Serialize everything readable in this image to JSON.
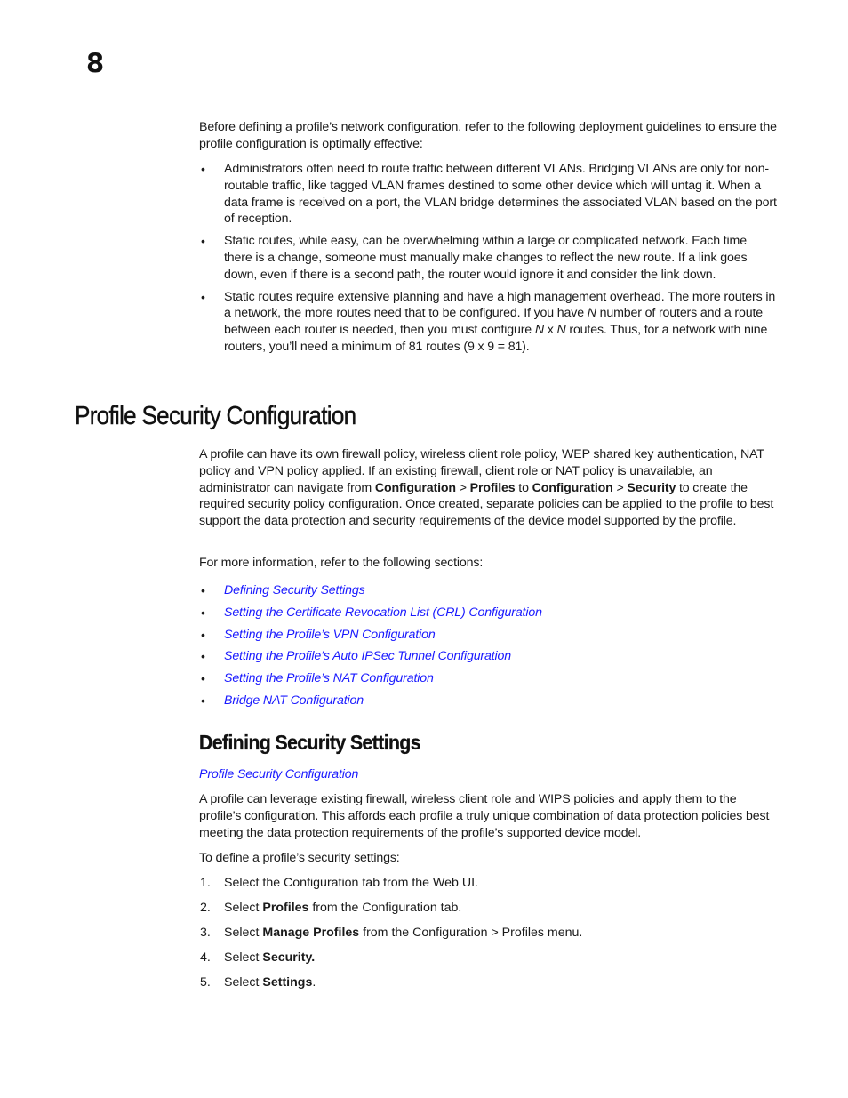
{
  "page": {
    "chapter_number": "8"
  },
  "intro": {
    "text": "Before defining a profile’s network configuration, refer to the following deployment guidelines to ensure the profile configuration is optimally effective:",
    "bullets": [
      "Administrators often need to route traffic between different VLANs. Bridging VLANs are only for non-routable traffic, like tagged VLAN frames destined to some other device which will untag it. When a data frame is received on a port, the VLAN bridge determines the associated VLAN based on the port of reception.",
      "Static routes, while easy, can be overwhelming within a large or complicated network. Each time there is a change, someone must manually make changes to reflect the new route. If a link goes down, even if there is a second path, the router would ignore it and consider the link down."
    ],
    "bullet3": {
      "part1": "Static routes require extensive planning and have a high management overhead. The more routers in a network, the more routes need that to be configured. If you have ",
      "n1": "N",
      "part2": " number of routers and a route between each router is needed, then you must configure ",
      "n2": "N",
      "x": " x ",
      "n3": "N",
      "part3": " routes. Thus, for a network with nine routers, you’ll need a minimum of 81 routes (9 x 9 = 81)."
    }
  },
  "section": {
    "title": "Profile Security Configuration",
    "para": {
      "part1": "A profile can have its own firewall policy, wireless client role policy, WEP shared key authentication, NAT policy and VPN policy applied. If an existing firewall, client role or NAT policy is unavailable, an administrator can navigate from ",
      "b1": "Configuration",
      "sep1": " > ",
      "b2": "Profiles",
      "mid": " to ",
      "b3": "Configuration",
      "sep2": " > ",
      "b4": "Security",
      "part2": " to create the required security policy configuration. Once created, separate policies can be applied to the profile to best support the data protection and security requirements of the device model supported by the profile."
    },
    "more_info": "For more information, refer to the following sections:",
    "bullet_glyph": "•",
    "links": [
      "Defining Security Settings",
      "Setting the Certificate Revocation List (CRL) Configuration",
      "Setting the Profile’s VPN Configuration",
      "Setting the Profile’s Auto IPSec Tunnel Configuration",
      "Setting the Profile’s NAT Configuration",
      "Bridge NAT Configuration"
    ],
    "link_color": "#1a1aff"
  },
  "subsection": {
    "title": "Defining Security Settings",
    "back_link": "Profile Security Configuration",
    "para": "A profile can leverage existing firewall, wireless client role and WIPS policies and apply them to the profile’s configuration. This affords each profile a truly unique combination of data protection policies best meeting the data protection requirements of the profile’s supported device model.",
    "steps_intro": "To define a profile’s security settings:",
    "steps": [
      {
        "num": "1.",
        "pre": "Select the Configuration tab from the Web UI.",
        "bold": "",
        "post": ""
      },
      {
        "num": "2.",
        "pre": "Select ",
        "bold": "Profiles",
        "post": " from the Configuration tab."
      },
      {
        "num": "3.",
        "pre": "Select ",
        "bold": "Manage Profiles",
        "post": " from the Configuration > Profiles menu."
      },
      {
        "num": "4.",
        "pre": "Select ",
        "bold": "Security.",
        "post": ""
      },
      {
        "num": "5.",
        "pre": "Select ",
        "bold": "Settings",
        "post": "."
      }
    ]
  }
}
